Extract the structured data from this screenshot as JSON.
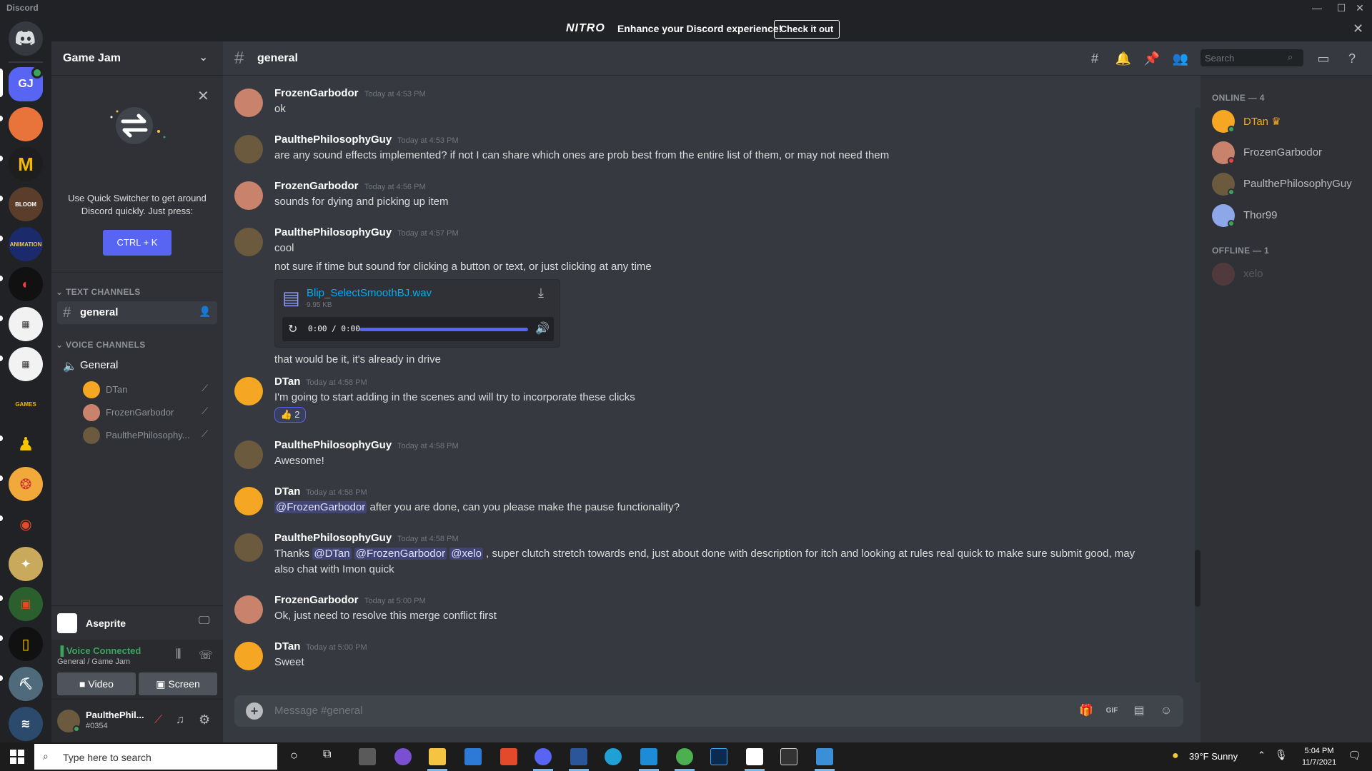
{
  "app_title": "Discord",
  "nitro": {
    "logo": "NITRO",
    "message": "Enhance your Discord experience!",
    "button": "Check it out"
  },
  "guild_initials": "GJ",
  "server": {
    "name": "Game Jam"
  },
  "quick_switcher": {
    "text_line1": "Use Quick Switcher to get around",
    "text_line2": "Discord quickly. Just press:",
    "button": "CTRL + K"
  },
  "categories": {
    "text": "TEXT CHANNELS",
    "voice": "VOICE CHANNELS"
  },
  "text_channel": "general",
  "voice_channel": "General",
  "voice_users": [
    "DTan",
    "FrozenGarbodor",
    "PaulthePhilosophy..."
  ],
  "activity": {
    "name": "Aseprite"
  },
  "voice_status": {
    "title": "Voice Connected",
    "location": "General / Game Jam",
    "video": "Video",
    "screen": "Screen"
  },
  "user_panel": {
    "name": "PaulthePhil...",
    "tag": "#0354"
  },
  "chat": {
    "channel": "general",
    "search_placeholder": "Search",
    "composer_placeholder": "Message #general"
  },
  "messages": [
    {
      "author": "FrozenGarbodor",
      "time": "Today at 4:53 PM",
      "lines": [
        "ok"
      ]
    },
    {
      "author": "PaulthePhilosophyGuy",
      "time": "Today at 4:53 PM",
      "lines": [
        "are any sound effects implemented? if not I can share which ones are prob best from the entire list of them, or may not need them"
      ]
    },
    {
      "author": "FrozenGarbodor",
      "time": "Today at 4:56 PM",
      "lines": [
        "sounds for dying and picking up item"
      ]
    },
    {
      "author": "PaulthePhilosophyGuy",
      "time": "Today at 4:57 PM",
      "lines": [
        "cool",
        "not sure if time but sound for clicking a button or text, or just clicking at any time",
        "that would be it, it's already in drive"
      ]
    },
    {
      "author": "DTan",
      "time": "Today at 4:58 PM",
      "lines": [
        "I'm going to start adding in the scenes and will try to incorporate these clicks"
      ],
      "reaction": "👍 2"
    },
    {
      "author": "PaulthePhilosophyGuy",
      "time": "Today at 4:58 PM",
      "lines": [
        "Awesome!"
      ]
    },
    {
      "author": "DTan",
      "time": "Today at 4:58 PM",
      "mention": "@FrozenGarbodor",
      "lines": [
        " after you are done, can you please make the pause functionality?"
      ]
    },
    {
      "author": "PaulthePhilosophyGuy",
      "time": "Today at 4:58 PM",
      "prefix": "Thanks ",
      "mentions": [
        "@DTan",
        "@FrozenGarbodor",
        "@xelo"
      ],
      "lines": [
        " , super clutch stretch towards end, just about done with description for itch and looking at rules real quick to make sure submit good, may",
        "also chat with Imon quick"
      ]
    },
    {
      "author": "FrozenGarbodor",
      "time": "Today at 5:00 PM",
      "lines": [
        "Ok, just need to resolve this merge conflict first"
      ]
    },
    {
      "author": "DTan",
      "time": "Today at 5:00 PM",
      "lines": [
        "Sweet"
      ]
    }
  ],
  "attachment": {
    "filename": "Blip_SelectSmoothBJ.wav",
    "size": "9.95 KB",
    "time": "0:00 / 0:00"
  },
  "members": {
    "online_header": "ONLINE — 4",
    "offline_header": "OFFLINE — 1",
    "online": [
      "DTan",
      "FrozenGarbodor",
      "PaulthePhilosophyGuy",
      "Thor99"
    ],
    "offline": [
      "xelo"
    ]
  },
  "taskbar": {
    "search_placeholder": "Type here to search",
    "weather": "39°F  Sunny",
    "time": "5:04 PM",
    "date": "11/7/2021"
  },
  "colors": {
    "blurple": "#5865f2",
    "online": "#3ba55d",
    "dnd": "#ed4245",
    "bg": "#36393f"
  }
}
